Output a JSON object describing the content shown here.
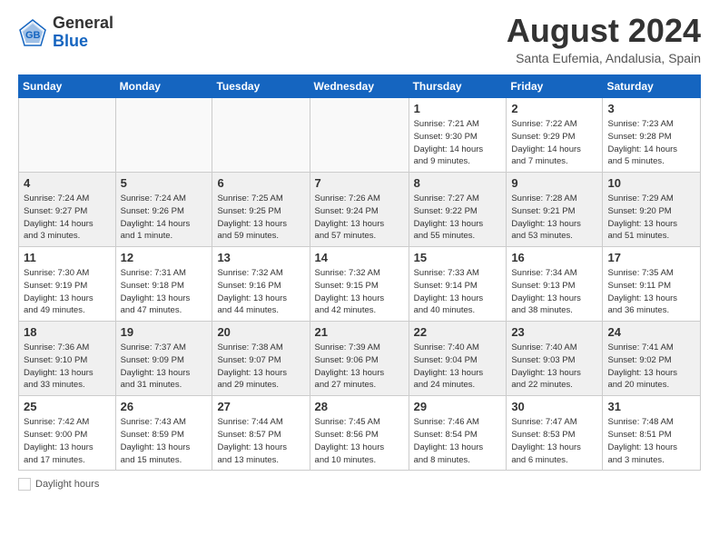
{
  "header": {
    "logo_line1": "General",
    "logo_line2": "Blue",
    "month_title": "August 2024",
    "subtitle": "Santa Eufemia, Andalusia, Spain"
  },
  "weekdays": [
    "Sunday",
    "Monday",
    "Tuesday",
    "Wednesday",
    "Thursday",
    "Friday",
    "Saturday"
  ],
  "weeks": [
    [
      {
        "day": "",
        "info": ""
      },
      {
        "day": "",
        "info": ""
      },
      {
        "day": "",
        "info": ""
      },
      {
        "day": "",
        "info": ""
      },
      {
        "day": "1",
        "info": "Sunrise: 7:21 AM\nSunset: 9:30 PM\nDaylight: 14 hours\nand 9 minutes."
      },
      {
        "day": "2",
        "info": "Sunrise: 7:22 AM\nSunset: 9:29 PM\nDaylight: 14 hours\nand 7 minutes."
      },
      {
        "day": "3",
        "info": "Sunrise: 7:23 AM\nSunset: 9:28 PM\nDaylight: 14 hours\nand 5 minutes."
      }
    ],
    [
      {
        "day": "4",
        "info": "Sunrise: 7:24 AM\nSunset: 9:27 PM\nDaylight: 14 hours\nand 3 minutes."
      },
      {
        "day": "5",
        "info": "Sunrise: 7:24 AM\nSunset: 9:26 PM\nDaylight: 14 hours\nand 1 minute."
      },
      {
        "day": "6",
        "info": "Sunrise: 7:25 AM\nSunset: 9:25 PM\nDaylight: 13 hours\nand 59 minutes."
      },
      {
        "day": "7",
        "info": "Sunrise: 7:26 AM\nSunset: 9:24 PM\nDaylight: 13 hours\nand 57 minutes."
      },
      {
        "day": "8",
        "info": "Sunrise: 7:27 AM\nSunset: 9:22 PM\nDaylight: 13 hours\nand 55 minutes."
      },
      {
        "day": "9",
        "info": "Sunrise: 7:28 AM\nSunset: 9:21 PM\nDaylight: 13 hours\nand 53 minutes."
      },
      {
        "day": "10",
        "info": "Sunrise: 7:29 AM\nSunset: 9:20 PM\nDaylight: 13 hours\nand 51 minutes."
      }
    ],
    [
      {
        "day": "11",
        "info": "Sunrise: 7:30 AM\nSunset: 9:19 PM\nDaylight: 13 hours\nand 49 minutes."
      },
      {
        "day": "12",
        "info": "Sunrise: 7:31 AM\nSunset: 9:18 PM\nDaylight: 13 hours\nand 47 minutes."
      },
      {
        "day": "13",
        "info": "Sunrise: 7:32 AM\nSunset: 9:16 PM\nDaylight: 13 hours\nand 44 minutes."
      },
      {
        "day": "14",
        "info": "Sunrise: 7:32 AM\nSunset: 9:15 PM\nDaylight: 13 hours\nand 42 minutes."
      },
      {
        "day": "15",
        "info": "Sunrise: 7:33 AM\nSunset: 9:14 PM\nDaylight: 13 hours\nand 40 minutes."
      },
      {
        "day": "16",
        "info": "Sunrise: 7:34 AM\nSunset: 9:13 PM\nDaylight: 13 hours\nand 38 minutes."
      },
      {
        "day": "17",
        "info": "Sunrise: 7:35 AM\nSunset: 9:11 PM\nDaylight: 13 hours\nand 36 minutes."
      }
    ],
    [
      {
        "day": "18",
        "info": "Sunrise: 7:36 AM\nSunset: 9:10 PM\nDaylight: 13 hours\nand 33 minutes."
      },
      {
        "day": "19",
        "info": "Sunrise: 7:37 AM\nSunset: 9:09 PM\nDaylight: 13 hours\nand 31 minutes."
      },
      {
        "day": "20",
        "info": "Sunrise: 7:38 AM\nSunset: 9:07 PM\nDaylight: 13 hours\nand 29 minutes."
      },
      {
        "day": "21",
        "info": "Sunrise: 7:39 AM\nSunset: 9:06 PM\nDaylight: 13 hours\nand 27 minutes."
      },
      {
        "day": "22",
        "info": "Sunrise: 7:40 AM\nSunset: 9:04 PM\nDaylight: 13 hours\nand 24 minutes."
      },
      {
        "day": "23",
        "info": "Sunrise: 7:40 AM\nSunset: 9:03 PM\nDaylight: 13 hours\nand 22 minutes."
      },
      {
        "day": "24",
        "info": "Sunrise: 7:41 AM\nSunset: 9:02 PM\nDaylight: 13 hours\nand 20 minutes."
      }
    ],
    [
      {
        "day": "25",
        "info": "Sunrise: 7:42 AM\nSunset: 9:00 PM\nDaylight: 13 hours\nand 17 minutes."
      },
      {
        "day": "26",
        "info": "Sunrise: 7:43 AM\nSunset: 8:59 PM\nDaylight: 13 hours\nand 15 minutes."
      },
      {
        "day": "27",
        "info": "Sunrise: 7:44 AM\nSunset: 8:57 PM\nDaylight: 13 hours\nand 13 minutes."
      },
      {
        "day": "28",
        "info": "Sunrise: 7:45 AM\nSunset: 8:56 PM\nDaylight: 13 hours\nand 10 minutes."
      },
      {
        "day": "29",
        "info": "Sunrise: 7:46 AM\nSunset: 8:54 PM\nDaylight: 13 hours\nand 8 minutes."
      },
      {
        "day": "30",
        "info": "Sunrise: 7:47 AM\nSunset: 8:53 PM\nDaylight: 13 hours\nand 6 minutes."
      },
      {
        "day": "31",
        "info": "Sunrise: 7:48 AM\nSunset: 8:51 PM\nDaylight: 13 hours\nand 3 minutes."
      }
    ]
  ],
  "legend": {
    "daylight_label": "Daylight hours"
  }
}
